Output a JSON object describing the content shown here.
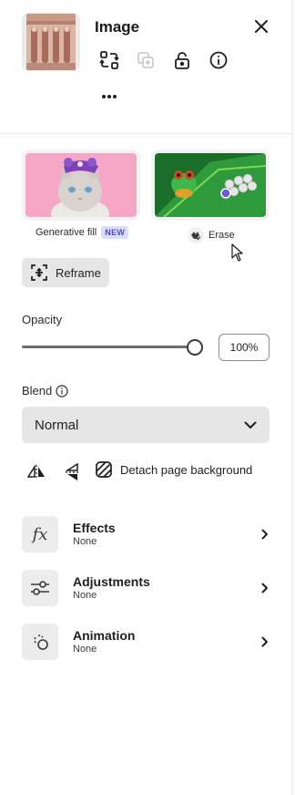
{
  "header": {
    "title": "Image",
    "thumbnail_alt": "Caryatids statue photo"
  },
  "quick_actions": {
    "generative_fill": {
      "label": "Generative fill",
      "badge": "NEW"
    },
    "erase": {
      "label": "Erase"
    }
  },
  "reframe": {
    "label": "Reframe"
  },
  "opacity": {
    "label": "Opacity",
    "value_text": "100%",
    "value_fraction": 1.0
  },
  "blend": {
    "label": "Blend",
    "selected": "Normal"
  },
  "detach": {
    "label": "Detach page background"
  },
  "sections": [
    {
      "title": "Effects",
      "subtitle": "None",
      "icon": "fx-icon"
    },
    {
      "title": "Adjustments",
      "subtitle": "None",
      "icon": "sliders-icon"
    },
    {
      "title": "Animation",
      "subtitle": "None",
      "icon": "animation-icon"
    }
  ],
  "colors": {
    "badge_bg": "#dcdcfb",
    "badge_text": "#4b4bd6",
    "control_bg": "#e6e6e6"
  }
}
